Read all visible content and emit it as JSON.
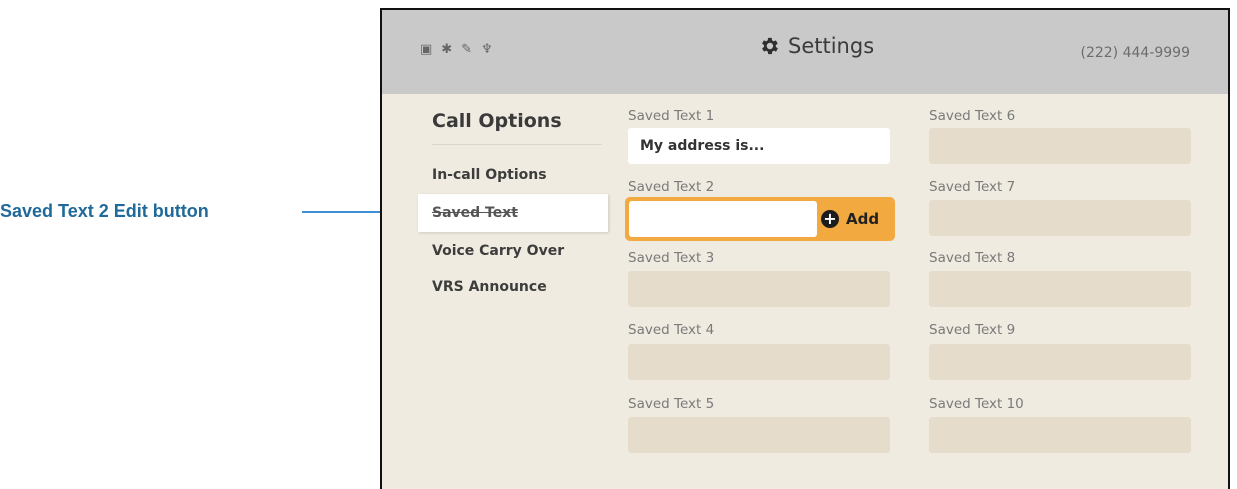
{
  "callout": {
    "label": "Saved Text 2 Edit button"
  },
  "header": {
    "status_icons": [
      "▣",
      "✱",
      "✎",
      "♆"
    ],
    "title": "Settings",
    "phone": "(222) 444-9999"
  },
  "sidebar": {
    "title": "Call Options",
    "items": [
      {
        "label": "In-call Options"
      },
      {
        "label": "Saved Text"
      },
      {
        "label": "Voice Carry Over"
      },
      {
        "label": "VRS Announce"
      }
    ]
  },
  "fields": {
    "f1": {
      "label": "Saved Text 1",
      "value": "My address is..."
    },
    "f2": {
      "label": "Saved Text 2",
      "add_label": "Add"
    },
    "f3": {
      "label": "Saved Text 3"
    },
    "f4": {
      "label": "Saved Text 4"
    },
    "f5": {
      "label": "Saved Text 5"
    },
    "f6": {
      "label": "Saved Text 6"
    },
    "f7": {
      "label": "Saved Text 7"
    },
    "f8": {
      "label": "Saved Text 8"
    },
    "f9": {
      "label": "Saved Text 9"
    },
    "f10": {
      "label": "Saved Text 10"
    }
  },
  "colors": {
    "accent": "#f2a93f",
    "callout": "#1f6a9a",
    "arrow": "#3d8fd6"
  }
}
